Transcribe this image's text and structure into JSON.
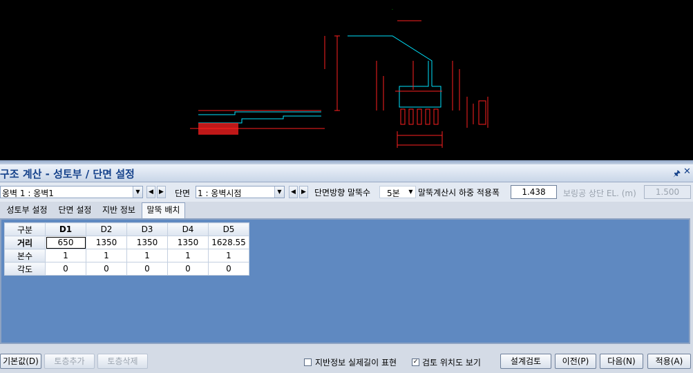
{
  "window": {
    "title": "구조 계산 - 성토부 / 단면 설정",
    "pin_icon": "pin-icon",
    "close_icon": "close-icon"
  },
  "toolbar": {
    "wall_select": "옹벽 1 : 옹벽1",
    "section_label": "단면",
    "section_select": "1 : 옹벽시점",
    "pile_count_label": "단면방향 말뚝수",
    "pile_count_select": "5본",
    "load_width_label": "말뚝계산시 하중 적용폭",
    "load_width_value": "1.438",
    "boring_label": "보링공 상단 EL. (m)",
    "boring_value": "1.500"
  },
  "tabs": [
    "성토부 설정",
    "단면 설정",
    "지반 정보",
    "말뚝 배치"
  ],
  "active_tab": "말뚝 배치",
  "grid": {
    "corner": "구분",
    "columns": [
      "D1",
      "D2",
      "D3",
      "D4",
      "D5"
    ],
    "rows": [
      {
        "label": "거리",
        "values": [
          "650",
          "1350",
          "1350",
          "1350",
          "1628.55"
        ]
      },
      {
        "label": "본수",
        "values": [
          "1",
          "1",
          "1",
          "1",
          "1"
        ]
      },
      {
        "label": "각도",
        "values": [
          "0",
          "0",
          "0",
          "0",
          "0"
        ]
      }
    ]
  },
  "bottom": {
    "default_button": "기본값(D)",
    "add_layer_button": "토층추가",
    "delete_layer_button": "토층삭제",
    "real_depth_label": "지반정보 실제길이 표현",
    "real_depth_checked": false,
    "show_location_label": "검토 위치도 보기",
    "show_location_checked": true,
    "design_check_button": "설계검토",
    "prev_button": "이전(P)",
    "next_button": "다음(N)",
    "apply_button": "적용(A)"
  },
  "colors": {
    "cad_bg": "#000000",
    "cad_cyan": "#00e5ff",
    "cad_red": "#ff2020",
    "cad_green": "#00ff00",
    "cad_yellow": "#ffff00",
    "panel_bg": "#5f89c1",
    "title_text": "#15428b"
  }
}
